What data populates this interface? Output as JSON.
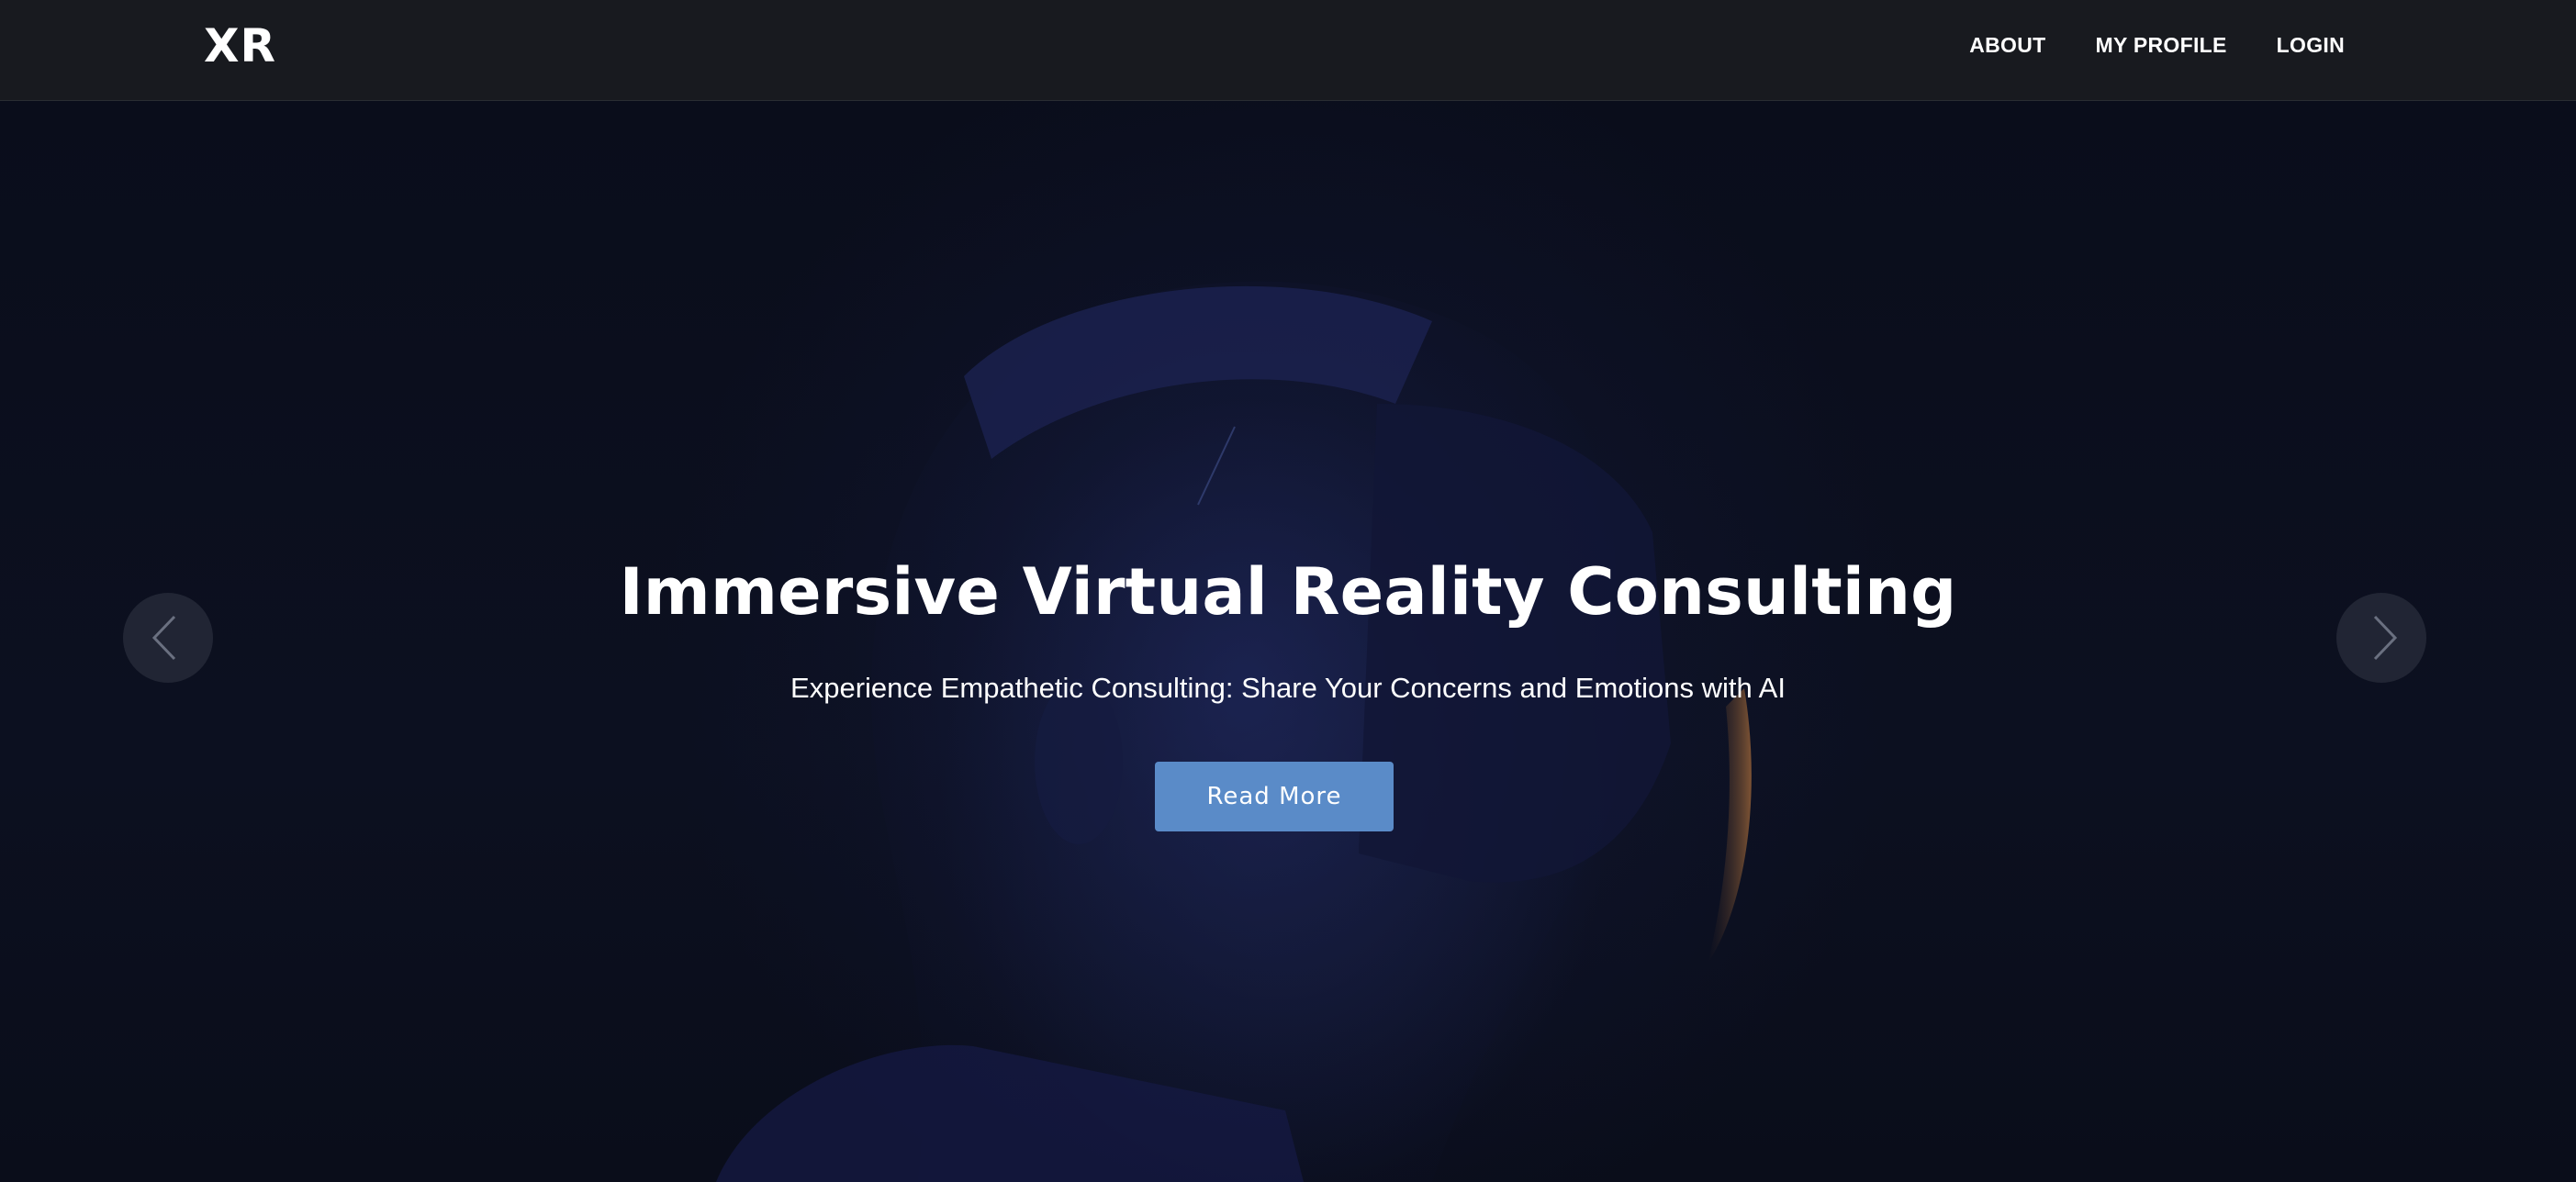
{
  "navbar": {
    "brand": "XR",
    "links": [
      {
        "label": "ABOUT"
      },
      {
        "label": "MY PROFILE"
      },
      {
        "label": "LOGIN"
      }
    ]
  },
  "hero": {
    "title": "Immersive Virtual Reality Consulting",
    "subtitle": "Experience Empathetic Consulting: Share Your Concerns and Emotions with AI",
    "cta_label": "Read More",
    "background_image": "person wearing VR headset",
    "prev_icon": "chevron-left-icon",
    "next_icon": "chevron-right-icon"
  },
  "colors": {
    "navbar_bg": "#181a1f",
    "hero_bg": "#0b0e1c",
    "accent": "#5a8bc8",
    "text": "#ffffff"
  }
}
